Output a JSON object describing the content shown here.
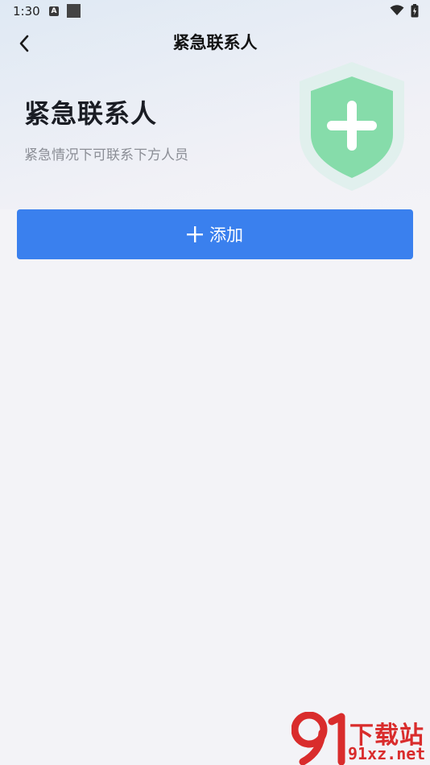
{
  "status_bar": {
    "time": "1:30",
    "notification_icon_letter": "A"
  },
  "nav": {
    "title": "紧急联系人"
  },
  "hero": {
    "title": "紧急联系人",
    "subtitle": "紧急情况下可联系下方人员"
  },
  "actions": {
    "add_label": "添加"
  },
  "colors": {
    "primary": "#3a80ee",
    "shield_green": "#7fd9a6",
    "text_dark": "#1a1d24",
    "text_muted": "#8b8e96",
    "background": "#f3f3f7"
  },
  "watermark": {
    "line1": "下载站",
    "line2": "91xz.net"
  }
}
